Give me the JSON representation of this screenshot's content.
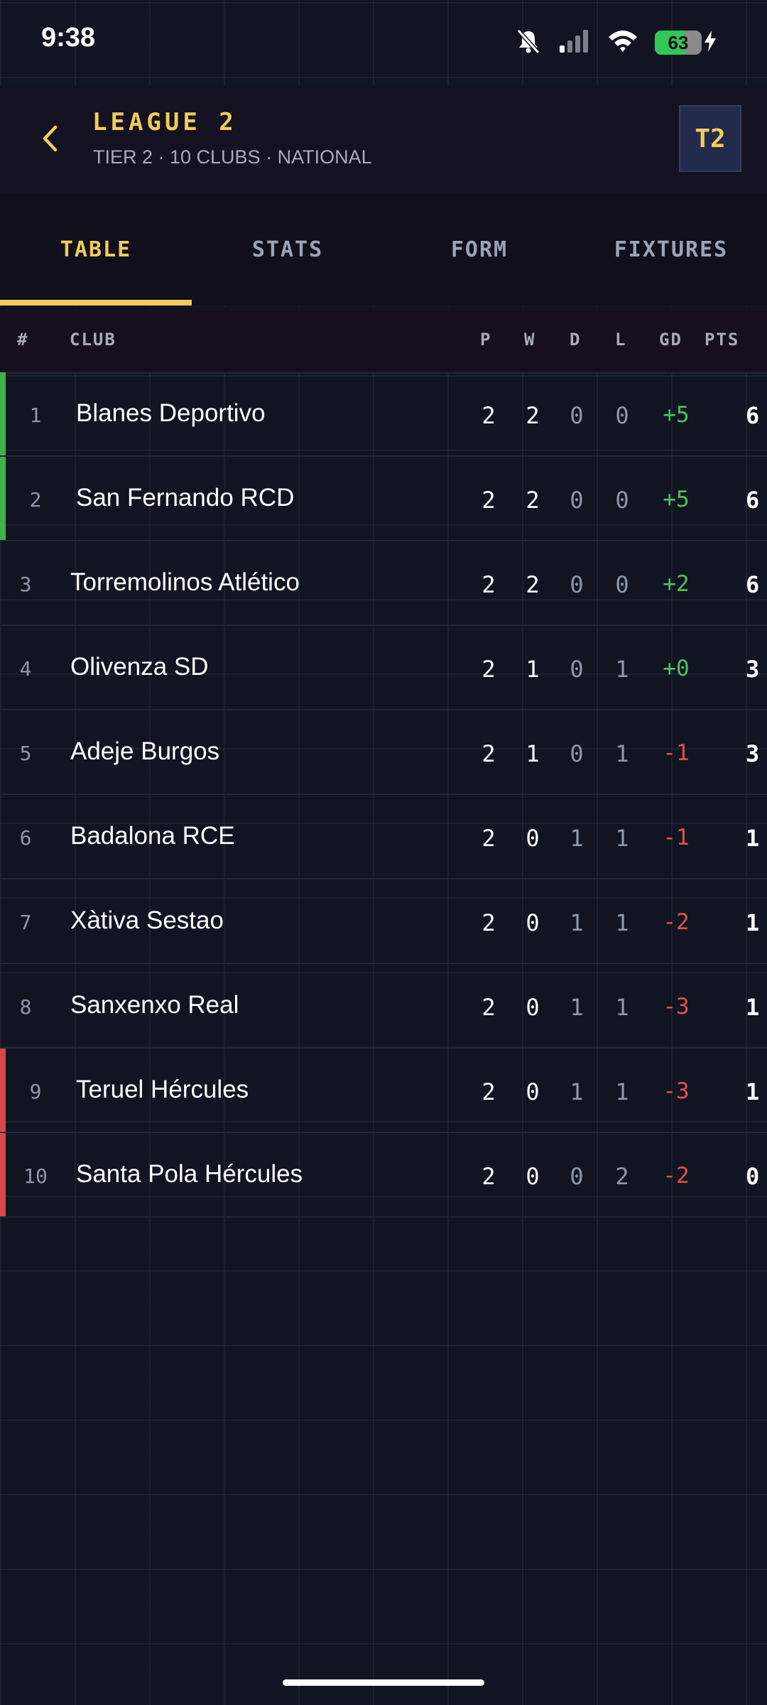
{
  "status_bar": {
    "time": "9:38",
    "battery": "63",
    "battery_level": 0.63
  },
  "header": {
    "title": "LEAGUE 2",
    "subtitle": "TIER 2 · 10 CLUBS · NATIONAL",
    "badge": "T2"
  },
  "tabs": [
    {
      "label": "TABLE",
      "active": true
    },
    {
      "label": "STATS",
      "active": false
    },
    {
      "label": "FORM",
      "active": false
    },
    {
      "label": "FIXTURES",
      "active": false
    }
  ],
  "table": {
    "columns": {
      "pos": "#",
      "club": "CLUB",
      "p": "P",
      "w": "W",
      "d": "D",
      "l": "L",
      "gd": "GD",
      "pts": "PTS"
    },
    "rows": [
      {
        "pos": "1",
        "club": "Blanes Deportivo",
        "p": "2",
        "w": "2",
        "d": "0",
        "l": "0",
        "gd": "+5",
        "pts": "6",
        "zone": "promotion"
      },
      {
        "pos": "2",
        "club": "San Fernando RCD",
        "p": "2",
        "w": "2",
        "d": "0",
        "l": "0",
        "gd": "+5",
        "pts": "6",
        "zone": "promotion"
      },
      {
        "pos": "3",
        "club": "Torremolinos Atlético",
        "p": "2",
        "w": "2",
        "d": "0",
        "l": "0",
        "gd": "+2",
        "pts": "6",
        "zone": "none"
      },
      {
        "pos": "4",
        "club": "Olivenza SD",
        "p": "2",
        "w": "1",
        "d": "0",
        "l": "1",
        "gd": "+0",
        "pts": "3",
        "zone": "none"
      },
      {
        "pos": "5",
        "club": "Adeje Burgos",
        "p": "2",
        "w": "1",
        "d": "0",
        "l": "1",
        "gd": "-1",
        "pts": "3",
        "zone": "none"
      },
      {
        "pos": "6",
        "club": "Badalona RCE",
        "p": "2",
        "w": "0",
        "d": "1",
        "l": "1",
        "gd": "-1",
        "pts": "1",
        "zone": "none"
      },
      {
        "pos": "7",
        "club": "Xàtiva Sestao",
        "p": "2",
        "w": "0",
        "d": "1",
        "l": "1",
        "gd": "-2",
        "pts": "1",
        "zone": "none"
      },
      {
        "pos": "8",
        "club": "Sanxenxo Real",
        "p": "2",
        "w": "0",
        "d": "1",
        "l": "1",
        "gd": "-3",
        "pts": "1",
        "zone": "none"
      },
      {
        "pos": "9",
        "club": "Teruel Hércules",
        "p": "2",
        "w": "0",
        "d": "1",
        "l": "1",
        "gd": "-3",
        "pts": "1",
        "zone": "relegation"
      },
      {
        "pos": "10",
        "club": "Santa Pola Hércules",
        "p": "2",
        "w": "0",
        "d": "0",
        "l": "2",
        "gd": "-2",
        "pts": "0",
        "zone": "relegation"
      }
    ]
  },
  "colors": {
    "accent": "#f1cc58",
    "promotion": "#3fb24c",
    "relegation": "#d9474a",
    "gd_positive": "#4ec25a",
    "gd_negative": "#e0504d"
  },
  "icons": {
    "back": "chevron-left-icon",
    "mute": "bell-slash-icon",
    "signal": "cellular-signal-icon",
    "wifi": "wifi-icon",
    "battery": "battery-icon",
    "charging": "bolt-icon"
  }
}
